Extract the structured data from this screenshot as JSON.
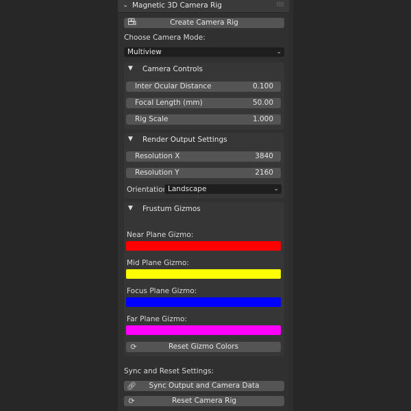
{
  "panel": {
    "title": "Magnetic 3D Camera Rig",
    "create_button": "Create Camera Rig",
    "mode_label": "Choose Camera Mode:",
    "mode_value": "Multiview"
  },
  "camera_controls": {
    "title": "Camera Controls",
    "fields": [
      {
        "label": "Inter Ocular Distance",
        "value": "0.100"
      },
      {
        "label": "Focal Length (mm)",
        "value": "50.00"
      },
      {
        "label": "Rig Scale",
        "value": "1.000"
      }
    ]
  },
  "render_output": {
    "title": "Render Output Settings",
    "fields": [
      {
        "label": "Resolution X",
        "value": "3840"
      },
      {
        "label": "Resolution Y",
        "value": "2160"
      }
    ],
    "orientation_label": "Orientation:",
    "orientation_value": "Landscape"
  },
  "frustum_gizmos": {
    "title": "Frustum Gizmos",
    "gizmos": [
      {
        "label": "Near Plane Gizmo:",
        "color": "#ff0000"
      },
      {
        "label": "Mid Plane Gizmo:",
        "color": "#ffff00"
      },
      {
        "label": "Focus Plane Gizmo:",
        "color": "#0000ff"
      },
      {
        "label": "Far Plane Gizmo:",
        "color": "#ff00ff"
      }
    ],
    "reset_button": "Reset Gizmo Colors"
  },
  "sync_reset": {
    "label": "Sync and Reset Settings:",
    "sync_button": "Sync Output and Camera Data",
    "reset_button": "Reset Camera Rig"
  },
  "icons": {
    "collapse": "chevron-down-icon",
    "drag": "drag-handle-icon",
    "camera": "camera-icon",
    "subpanel_toggle": "triangle-down-icon",
    "refresh": "refresh-icon",
    "link": "link-icon"
  }
}
